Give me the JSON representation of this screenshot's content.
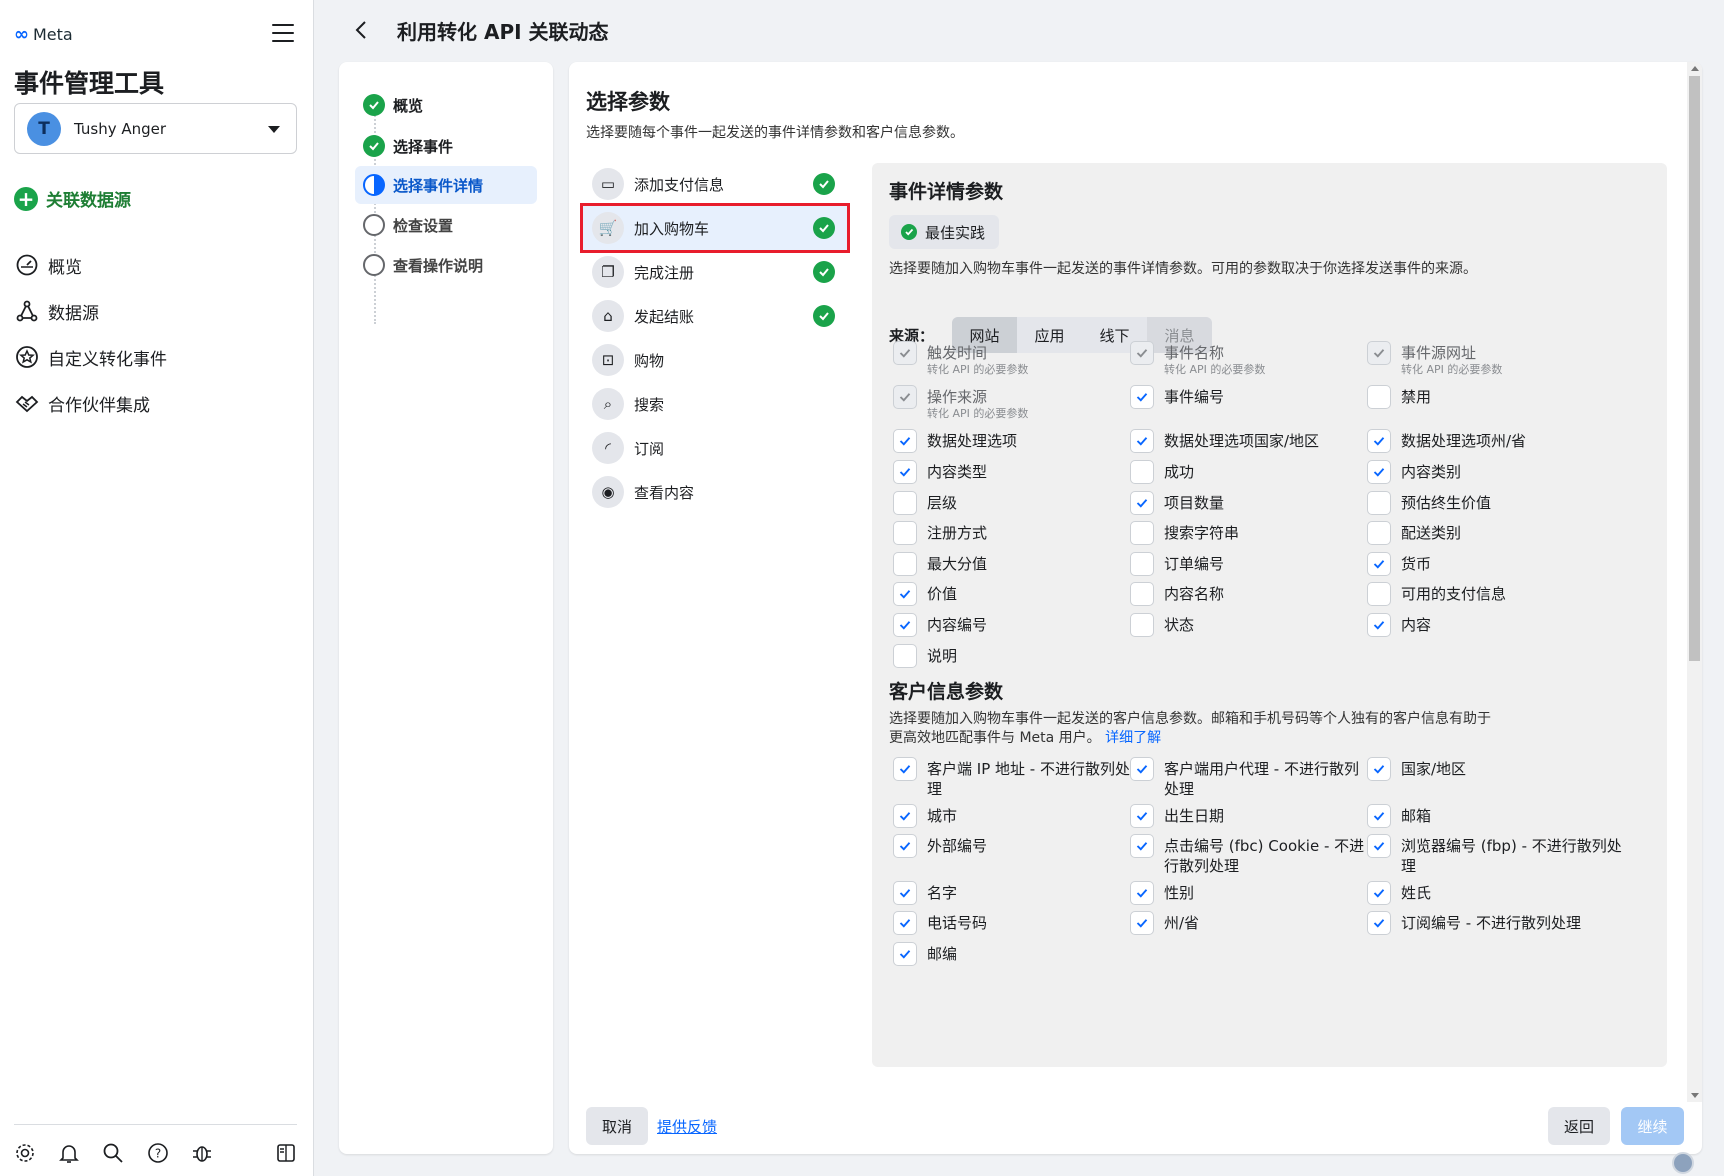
{
  "sidebar": {
    "brand": "Meta",
    "app_title": "事件管理工具",
    "account": {
      "initial": "T",
      "name": "Tushy Anger"
    },
    "connect_label": "关联数据源",
    "nav": [
      {
        "label": "概览",
        "icon": "dashboard-icon"
      },
      {
        "label": "数据源",
        "icon": "data-sources-icon"
      },
      {
        "label": "自定义转化事件",
        "icon": "star-badge-icon"
      },
      {
        "label": "合作伙伴集成",
        "icon": "handshake-icon"
      }
    ],
    "bottom_icons": [
      "settings-icon",
      "bell-icon",
      "search-icon",
      "help-icon",
      "bug-icon",
      "panel-toggle-icon"
    ]
  },
  "header": {
    "title": "利用转化 API 关联动态"
  },
  "steps": [
    {
      "label": "概览",
      "state": "done"
    },
    {
      "label": "选择事件",
      "state": "done"
    },
    {
      "label": "选择事件详情",
      "state": "current"
    },
    {
      "label": "检查设置",
      "state": "todo"
    },
    {
      "label": "查看操作说明",
      "state": "todo"
    }
  ],
  "main": {
    "title": "选择参数",
    "description": "选择要随每个事件一起发送的事件详情参数和客户信息参数。",
    "events": [
      {
        "label": "添加支付信息",
        "icon": "credit-card-icon",
        "glyph": "▭",
        "done": true
      },
      {
        "label": "加入购物车",
        "icon": "cart-icon",
        "glyph": "🛒",
        "done": true,
        "selected": true
      },
      {
        "label": "完成注册",
        "icon": "registration-icon",
        "glyph": "❐",
        "done": true
      },
      {
        "label": "发起结账",
        "icon": "basket-icon",
        "glyph": "⌂",
        "done": true
      },
      {
        "label": "购物",
        "icon": "shopping-bag-icon",
        "glyph": "⊡",
        "done": false
      },
      {
        "label": "搜索",
        "icon": "search-icon",
        "glyph": "⌕",
        "done": false
      },
      {
        "label": "订阅",
        "icon": "rss-icon",
        "glyph": "◜",
        "done": false
      },
      {
        "label": "查看内容",
        "icon": "eye-icon",
        "glyph": "◉",
        "done": false
      }
    ],
    "event_params": {
      "title": "事件详情参数",
      "best_practice": "最佳实践",
      "description": "选择要随加入购物车事件一起发送的事件详情参数。可用的参数取决于你选择发送事件的来源。",
      "source_label": "来源：",
      "sources": [
        "网站",
        "应用",
        "线下",
        "消息"
      ],
      "selected_source": "网站",
      "items": [
        {
          "label": "触发时间",
          "sub": "转化 API 的必要参数",
          "checked": true,
          "disabled": true
        },
        {
          "label": "事件名称",
          "sub": "转化 API 的必要参数",
          "checked": true,
          "disabled": true
        },
        {
          "label": "事件源网址",
          "sub": "转化 API 的必要参数",
          "checked": true,
          "disabled": true
        },
        {
          "label": "操作来源",
          "sub": "转化 API 的必要参数",
          "checked": true,
          "disabled": true
        },
        {
          "label": "事件编号",
          "checked": true
        },
        {
          "label": "禁用",
          "checked": false
        },
        {
          "label": "数据处理选项",
          "checked": true
        },
        {
          "label": "数据处理选项国家/地区",
          "checked": true
        },
        {
          "label": "数据处理选项州/省",
          "checked": true
        },
        {
          "label": "内容类型",
          "checked": true
        },
        {
          "label": "成功",
          "checked": false
        },
        {
          "label": "内容类别",
          "checked": true
        },
        {
          "label": "层级",
          "checked": false
        },
        {
          "label": "项目数量",
          "checked": true
        },
        {
          "label": "预估终生价值",
          "checked": false
        },
        {
          "label": "注册方式",
          "checked": false
        },
        {
          "label": "搜索字符串",
          "checked": false
        },
        {
          "label": "配送类别",
          "checked": false
        },
        {
          "label": "最大分值",
          "checked": false
        },
        {
          "label": "订单编号",
          "checked": false
        },
        {
          "label": "货币",
          "checked": true
        },
        {
          "label": "价值",
          "checked": true
        },
        {
          "label": "内容名称",
          "checked": false
        },
        {
          "label": "可用的支付信息",
          "checked": false
        },
        {
          "label": "内容编号",
          "checked": true
        },
        {
          "label": "状态",
          "checked": false
        },
        {
          "label": "内容",
          "checked": true
        },
        {
          "label": "说明",
          "checked": false
        }
      ]
    },
    "customer_params": {
      "title": "客户信息参数",
      "description": "选择要随加入购物车事件一起发送的客户信息参数。邮箱和手机号码等个人独有的客户信息有助于更高效地匹配事件与 Meta 用户。",
      "learn_more": "详细了解",
      "items": [
        {
          "label": "客户端 IP 地址 - 不进行散列处理",
          "checked": true
        },
        {
          "label": "客户端用户代理 - 不进行散列处理",
          "checked": true
        },
        {
          "label": "国家/地区",
          "checked": true
        },
        {
          "label": "城市",
          "checked": true
        },
        {
          "label": "出生日期",
          "checked": true
        },
        {
          "label": "邮箱",
          "checked": true
        },
        {
          "label": "外部编号",
          "checked": true
        },
        {
          "label": "点击编号 (fbc) Cookie - 不进行散列处理",
          "checked": true
        },
        {
          "label": "浏览器编号 (fbp) - 不进行散列处理",
          "checked": true
        },
        {
          "label": "名字",
          "checked": true
        },
        {
          "label": "性别",
          "checked": true
        },
        {
          "label": "姓氏",
          "checked": true
        },
        {
          "label": "电话号码",
          "checked": true
        },
        {
          "label": "州/省",
          "checked": true
        },
        {
          "label": "订阅编号 - 不进行散列处理",
          "checked": true
        },
        {
          "label": "邮编",
          "checked": true
        }
      ]
    },
    "footer": {
      "cancel": "取消",
      "feedback": "提供反馈",
      "back": "返回",
      "next": "继续"
    }
  },
  "colors": {
    "accent": "#0866ff",
    "success": "#1aa34a",
    "highlight_border": "#e81d2c"
  }
}
